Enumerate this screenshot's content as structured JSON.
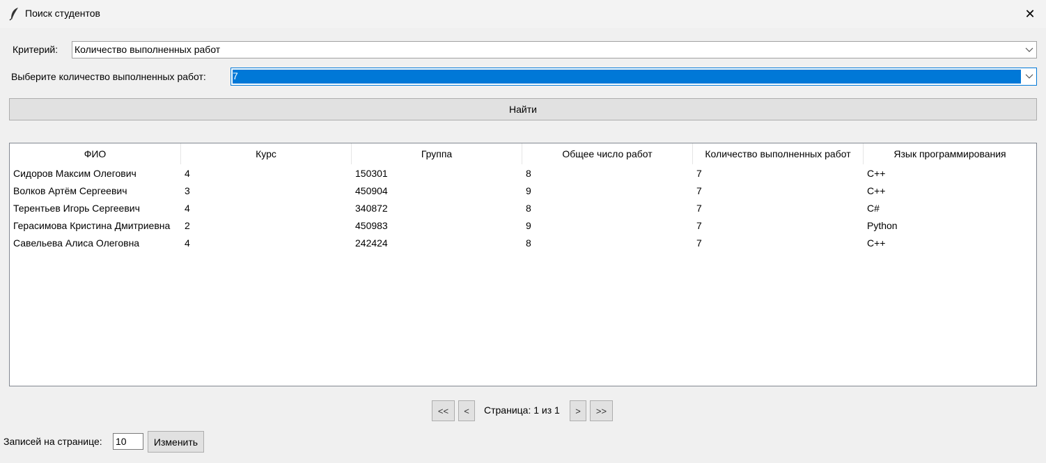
{
  "window": {
    "title": "Поиск студентов",
    "close_glyph": "✕",
    "icon": "feather-icon"
  },
  "criteria": {
    "label": "Критерий:",
    "value": "Количество выполненных работ"
  },
  "count_select": {
    "label": "Выберите количество выполненных работ:",
    "value": "7"
  },
  "find_button": "Найти",
  "table": {
    "columns": [
      "ФИО",
      "Курс",
      "Группа",
      "Общее число работ",
      "Количество выполненных работ",
      "Язык программирования"
    ],
    "rows": [
      [
        "Сидоров Максим Олегович",
        "4",
        "150301",
        "8",
        "7",
        "C++"
      ],
      [
        "Волков Артём Сергеевич",
        "3",
        "450904",
        "9",
        "7",
        "C++"
      ],
      [
        "Терентьев Игорь Сергеевич",
        "4",
        "340872",
        "8",
        "7",
        "C#"
      ],
      [
        "Герасимова Кристина Дмитриевна",
        "2",
        "450983",
        "9",
        "7",
        "Python"
      ],
      [
        "Савельева Алиса Олеговна",
        "4",
        "242424",
        "8",
        "7",
        "C++"
      ]
    ]
  },
  "pagination": {
    "first": "<<",
    "prev": "<",
    "page_label": "Страница: 1 из 1",
    "next": ">",
    "last": ">>"
  },
  "records": {
    "label": "Записей на странице:",
    "value": "10",
    "change_button": "Изменить"
  },
  "colors": {
    "selection": "#0078d7",
    "background": "#f0f0f0"
  }
}
